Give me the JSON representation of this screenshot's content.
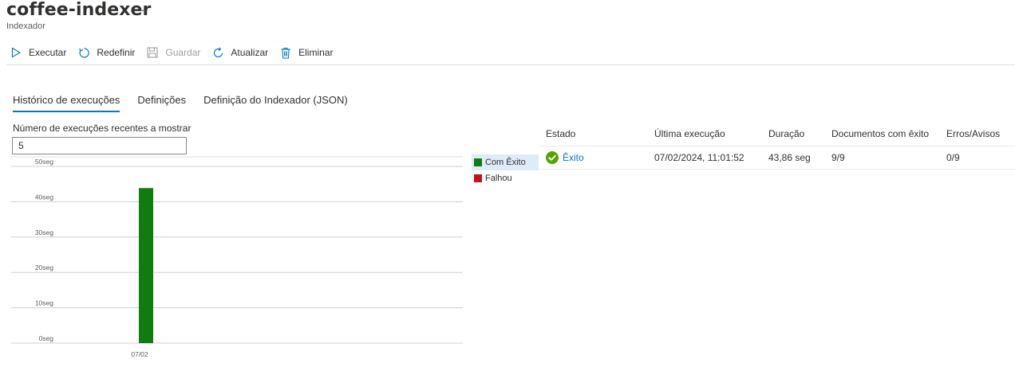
{
  "header": {
    "title": "coffee-indexer",
    "more_label": "···",
    "subtitle": "Indexador"
  },
  "toolbar": {
    "run_label": "Executar",
    "reset_label": "Redefinir",
    "save_label": "Guardar",
    "refresh_label": "Atualizar",
    "delete_label": "Eliminar"
  },
  "tabs": [
    {
      "label": "Histórico de execuções",
      "active": true
    },
    {
      "label": "Definições",
      "active": false
    },
    {
      "label": "Definição do Indexador (JSON)",
      "active": false
    }
  ],
  "recent_runs": {
    "label": "Número de execuções recentes a mostrar",
    "value": "5"
  },
  "legend": [
    {
      "label": "Com Êxito",
      "color": "#107c10"
    },
    {
      "label": "Falhou",
      "color": "#c50f1f"
    }
  ],
  "chart_data": {
    "type": "bar",
    "categories": [
      "07/02"
    ],
    "series": [
      {
        "name": "Com Êxito",
        "values": [
          43.86
        ],
        "color": "#107c10"
      }
    ],
    "yticks": [
      "0seg",
      "10seg",
      "20seg",
      "30seg",
      "40seg",
      "50seg"
    ],
    "ylim": [
      0,
      50
    ],
    "grid": true,
    "legend_position": "right"
  },
  "table": {
    "headers": [
      "Estado",
      "Última execução",
      "Duração",
      "Documentos com êxito",
      "Erros/Avisos"
    ],
    "rows": [
      {
        "status": "Êxito",
        "last_run": "07/02/2024, 11:01:52",
        "duration": "43,86 seg",
        "docs_ok": "9/9",
        "errors": "0/9"
      }
    ]
  },
  "colors": {
    "accent": "#0078d4",
    "success": "#107c10",
    "fail": "#c50f1f"
  }
}
